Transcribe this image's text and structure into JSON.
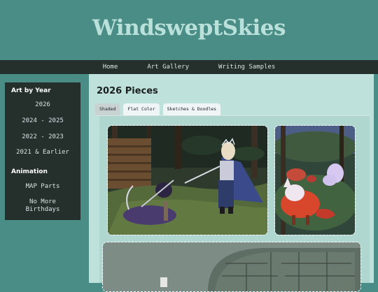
{
  "site": {
    "title": "WindsweptSkies"
  },
  "nav": {
    "items": [
      "Home",
      "Art Gallery",
      "Writing Samples"
    ]
  },
  "sidebar": {
    "art_heading": "Art by Year",
    "years": [
      "2026",
      "2024 - 2025",
      "2022 - 2023",
      "2021 & Earlier"
    ],
    "animation_heading": "Animation",
    "animation_items": [
      "MAP Parts",
      "No More\nBirthdays"
    ]
  },
  "main": {
    "heading": "2026 Pieces",
    "tabs": [
      "Shaded",
      "Flat Color",
      "Sketches & Doodles"
    ],
    "active_tab": "Shaded"
  },
  "colors": {
    "page_bg": "#4a8d86",
    "nav_bg": "#25302d",
    "title": "#b9e0d9",
    "content_bg": "#bfe1dc"
  }
}
